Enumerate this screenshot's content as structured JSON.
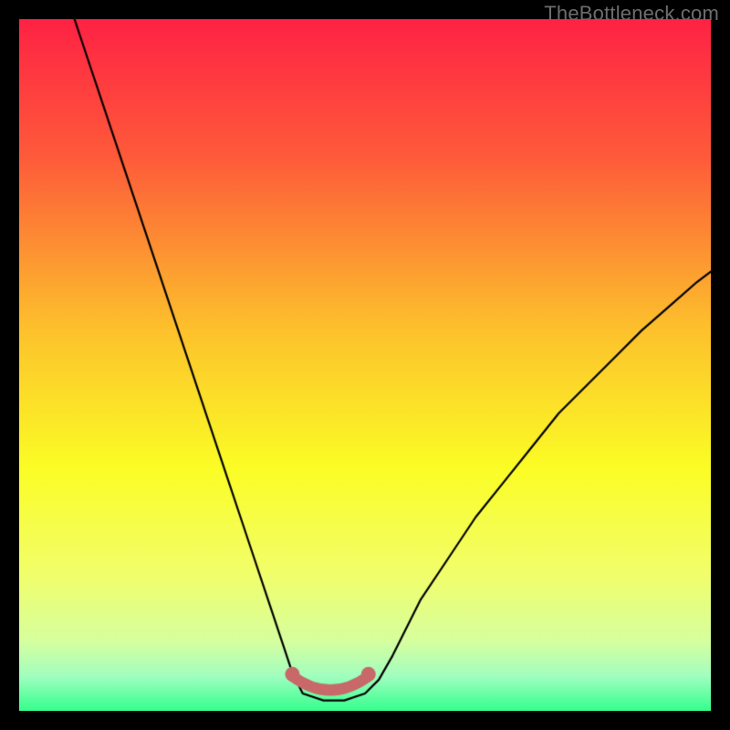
{
  "watermark": "TheBottleneck.com",
  "chart_data": {
    "type": "line",
    "title": "",
    "xlabel": "",
    "ylabel": "",
    "xlim": [
      0,
      100
    ],
    "ylim": [
      0,
      100
    ],
    "grid": false,
    "series": [
      {
        "name": "curve",
        "x": [
          8,
          10,
          12,
          14,
          16,
          18,
          20,
          22,
          24,
          26,
          28,
          30,
          32,
          34,
          36,
          38,
          39.5,
          41,
          44,
          47,
          50,
          52,
          54,
          56,
          58,
          62,
          66,
          70,
          74,
          78,
          82,
          86,
          90,
          94,
          98,
          100
        ],
        "y": [
          100,
          94,
          88,
          82,
          76,
          70,
          64,
          58,
          52,
          46,
          40,
          34,
          28,
          22,
          16,
          10,
          5.5,
          2.5,
          1.5,
          1.5,
          2.5,
          4.5,
          8,
          12,
          16,
          22,
          28,
          33,
          38,
          43,
          47,
          51,
          55,
          58.5,
          62,
          63.5
        ]
      }
    ],
    "marker_band": {
      "color": "#c86869",
      "x_range": [
        39.5,
        50.5
      ],
      "y": 2.5,
      "end_dot_radius": 1.0
    },
    "gradient_stops": [
      {
        "offset": 0.0,
        "color": "#fe2244"
      },
      {
        "offset": 0.2,
        "color": "#fe5b3a"
      },
      {
        "offset": 0.45,
        "color": "#fdc22c"
      },
      {
        "offset": 0.65,
        "color": "#fbfd26"
      },
      {
        "offset": 0.8,
        "color": "#f2fe6a"
      },
      {
        "offset": 0.9,
        "color": "#d6ff9f"
      },
      {
        "offset": 0.95,
        "color": "#a1fec0"
      },
      {
        "offset": 1.0,
        "color": "#35ff8d"
      }
    ]
  }
}
